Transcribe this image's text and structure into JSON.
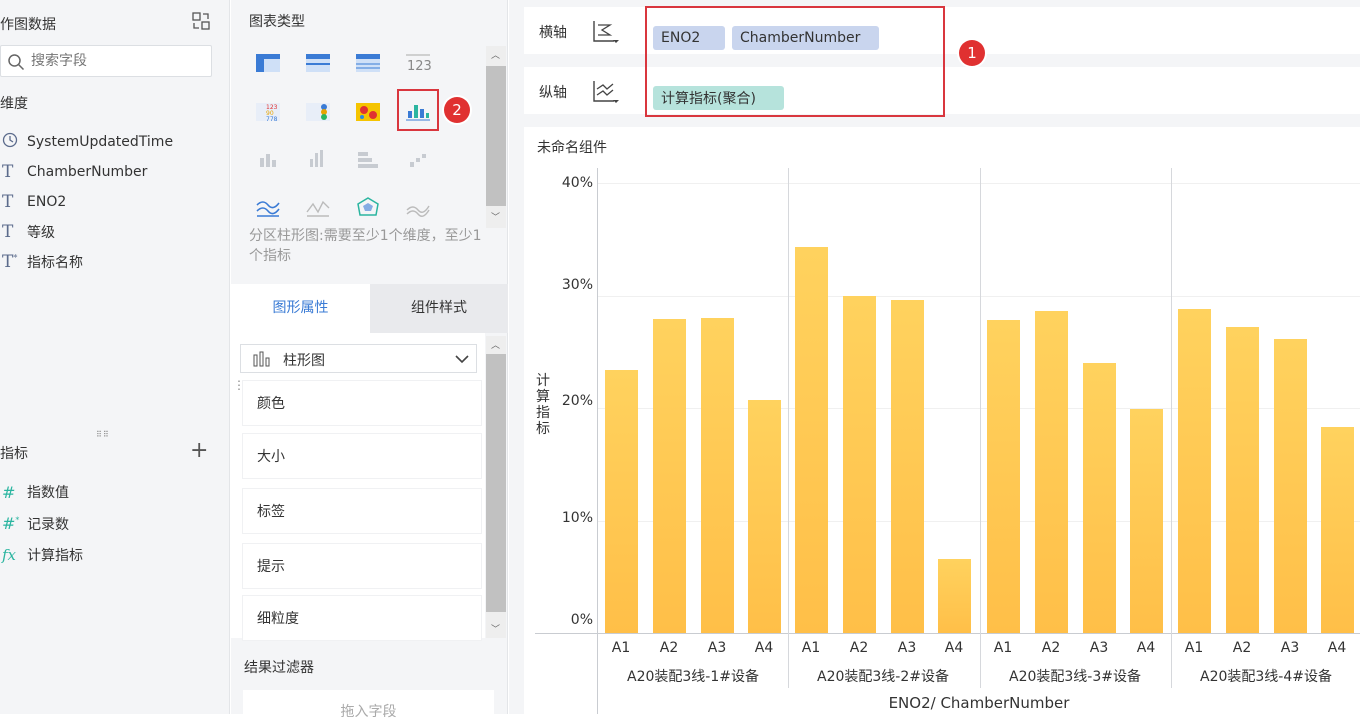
{
  "left": {
    "title": "作图数据",
    "search_placeholder": "搜索字段",
    "dims_title": "维度",
    "dims": [
      {
        "icon": "clock-icon",
        "label": "SystemUpdatedTime"
      },
      {
        "icon": "text-type-icon",
        "label": "ChamberNumber"
      },
      {
        "icon": "text-type-icon",
        "label": "ENO2"
      },
      {
        "icon": "text-type-icon",
        "label": "等级"
      },
      {
        "icon": "text-calc-type-icon",
        "label": "指标名称"
      }
    ],
    "measures_title": "指标",
    "measures": [
      {
        "icon": "hash-icon",
        "label": "指数值"
      },
      {
        "icon": "hash-calc-icon",
        "label": "记录数"
      },
      {
        "icon": "function-icon",
        "label": "计算指标"
      }
    ]
  },
  "mid": {
    "chart_types_title": "图表类型",
    "chart_hint": "分区柱形图:需要至少1个维度，至少1个指标",
    "tabs": [
      "图形属性",
      "组件样式"
    ],
    "chart_select": "柱形图",
    "props": [
      "颜色",
      "大小",
      "标签",
      "提示",
      "细粒度"
    ],
    "filter_title": "结果过滤器",
    "drop_placeholder": "拖入字段"
  },
  "axes": {
    "x_label": "横轴",
    "y_label": "纵轴",
    "x_pills": [
      "ENO2",
      "ChamberNumber"
    ],
    "y_pills": [
      "计算指标(聚合)"
    ]
  },
  "annotations": [
    "1",
    "2"
  ],
  "component_title": "未命名组件",
  "colors": {
    "bar_top": "#ffd25e",
    "bar_bottom": "#ffbf48",
    "pill_dim": "#c9d5ee",
    "pill_measure": "#b6e3dc",
    "accent": "#3a7bd5",
    "marker": "#e03131"
  },
  "chart_data": {
    "type": "bar",
    "title": "",
    "ylabel": "计算指标",
    "xlabel": "ENO2/ ChamberNumber",
    "ylim": [
      0,
      40
    ],
    "yticks": [
      "0%",
      "10%",
      "20%",
      "30%",
      "40%"
    ],
    "groups": [
      {
        "name": "A20装配3线-1#设备",
        "categories": [
          "A1",
          "A2",
          "A3",
          "A4"
        ],
        "values": [
          23.4,
          27.9,
          28.0,
          20.7
        ]
      },
      {
        "name": "A20装配3线-2#设备",
        "categories": [
          "A1",
          "A2",
          "A3",
          "A4"
        ],
        "values": [
          34.3,
          30.0,
          29.6,
          6.6
        ]
      },
      {
        "name": "A20装配3线-3#设备",
        "categories": [
          "A1",
          "A2",
          "A3",
          "A4"
        ],
        "values": [
          27.8,
          28.6,
          24.0,
          19.9
        ]
      },
      {
        "name": "A20装配3线-4#设备",
        "categories": [
          "A1",
          "A2",
          "A3",
          "A4"
        ],
        "values": [
          28.8,
          27.2,
          26.1,
          18.3
        ]
      }
    ]
  }
}
